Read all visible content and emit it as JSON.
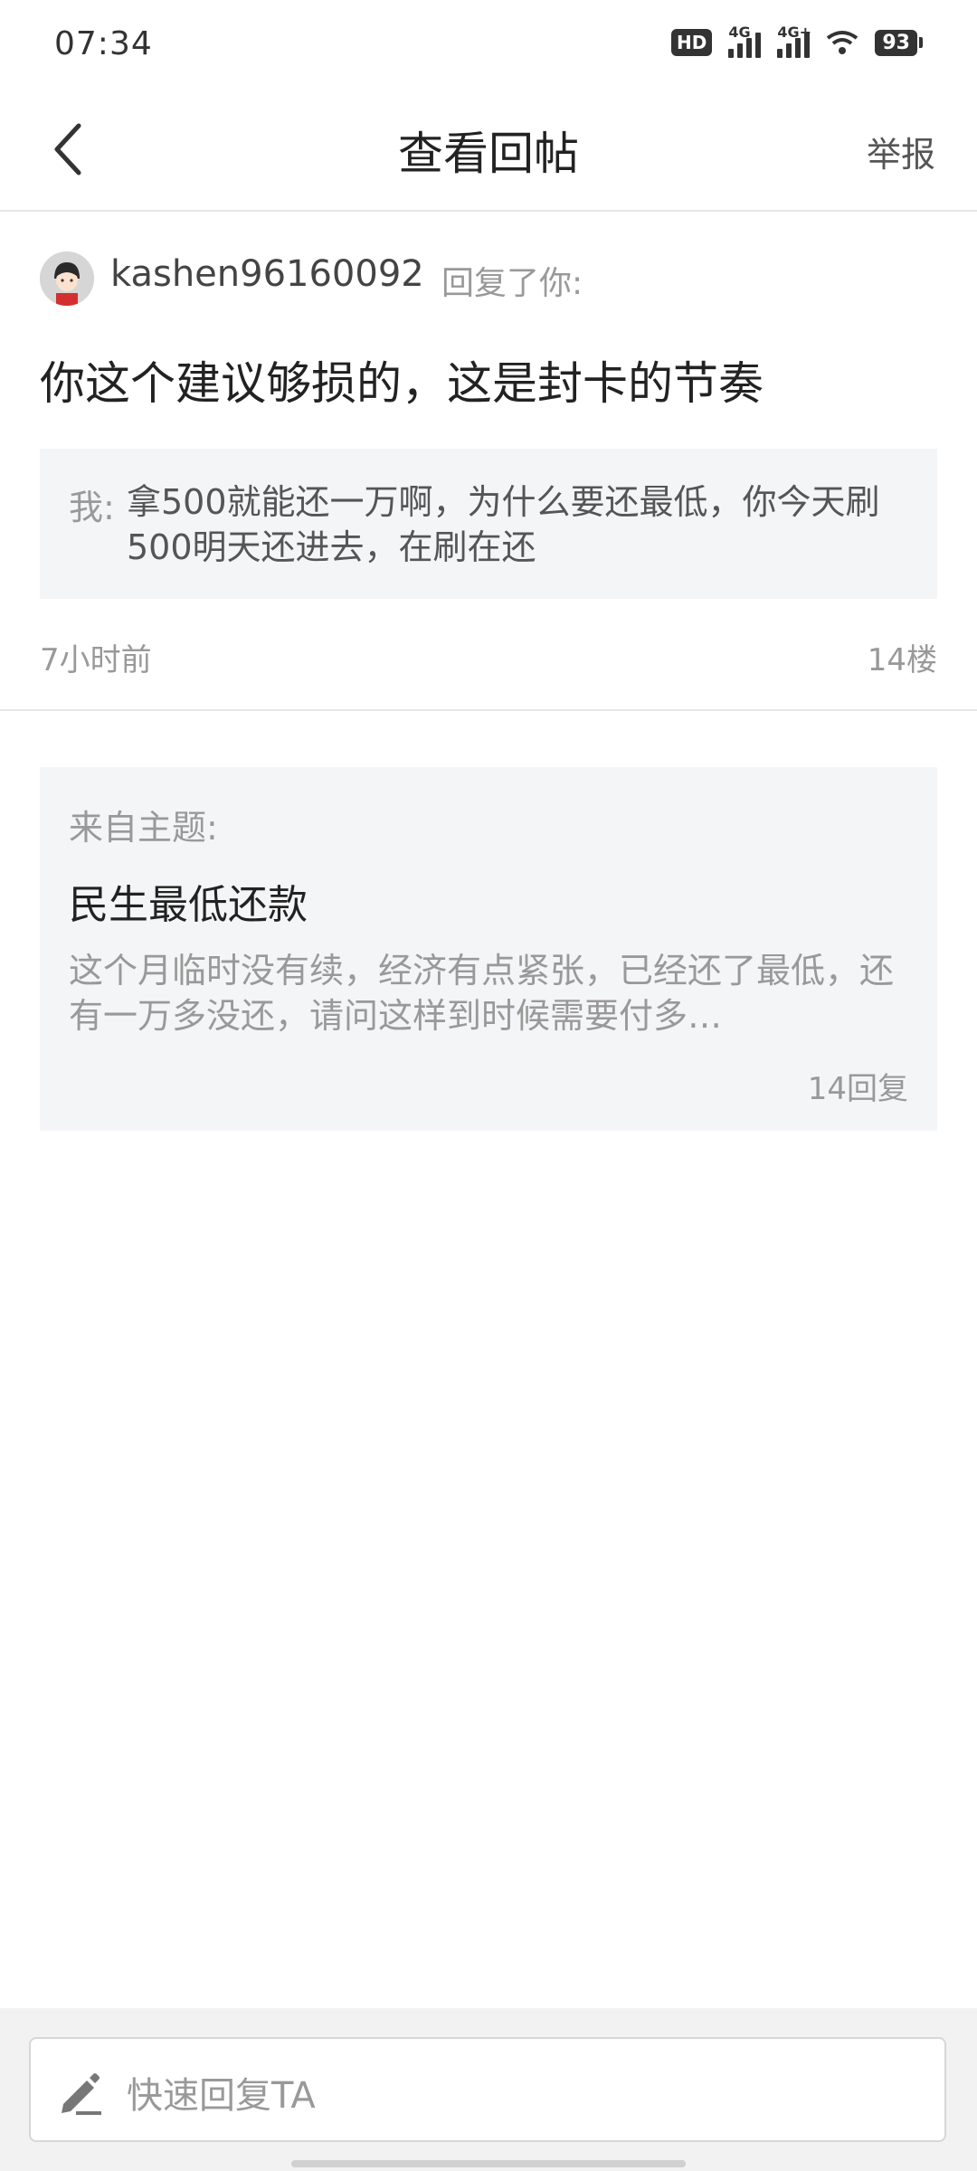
{
  "status_bar": {
    "time": "07:34",
    "hd_label": "HD",
    "signal1_label": "4G",
    "signal2_label": "4G+",
    "battery_level": "93"
  },
  "nav": {
    "title": "查看回帖",
    "report_label": "举报"
  },
  "reply": {
    "username": "kashen96160092",
    "replied_you": "回复了你:",
    "text": "你这个建议够损的，这是封卡的节奏",
    "quote_prefix": "我:",
    "quote_text": "拿500就能还一万啊，为什么要还最低，你今天刷500明天还进去，在刷在还",
    "time": "7小时前",
    "floor": "14楼"
  },
  "topic": {
    "from_label": "来自主题:",
    "title": "民生最低还款",
    "excerpt": "这个月临时没有续，经济有点紧张，已经还了最低，还有一万多没还，请问这样到时候需要付多…",
    "reply_count": "14回复"
  },
  "bottom": {
    "placeholder": "快速回复TA"
  },
  "colors": {
    "background": "#ffffff",
    "card_bg": "#f4f5f7",
    "text_primary": "#222222",
    "text_secondary": "#999999",
    "divider": "#e6e6e6"
  }
}
